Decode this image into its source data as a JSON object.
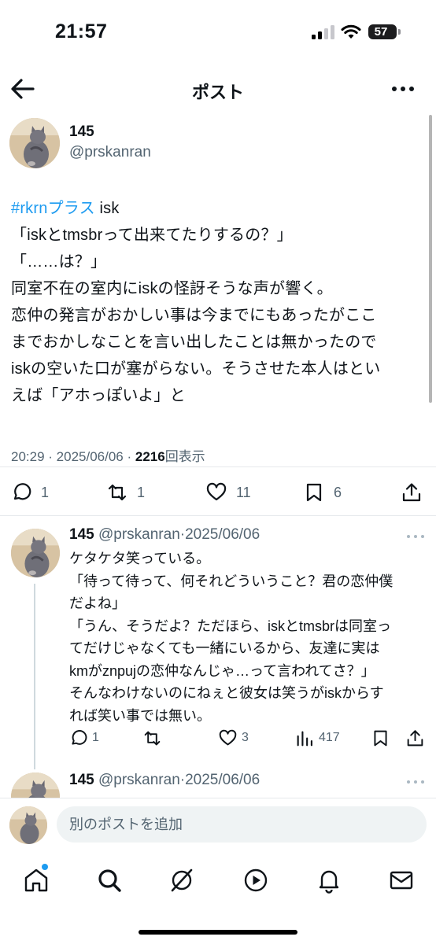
{
  "status_bar": {
    "time": "21:57",
    "battery": "57"
  },
  "header": {
    "title": "ポスト"
  },
  "post": {
    "author_name": "145",
    "author_handle": "@prskanran",
    "hashtag": "#rkrnプラス",
    "first_line_rest": " isk",
    "lines": [
      "「iskとtmsbrって出来てたりするの？」",
      "「……は？」",
      "同室不在の室内にiskの怪訝そうな声が響く。",
      "恋仲の発言がおかしい事は今までにもあったがここ",
      "までおかしなことを言い出したことは無かったので",
      "iskの空いた口が塞がらない。そうさせた本人はとい",
      "えば「アホっぽいよ」と"
    ],
    "time": "20:29",
    "date": "2025/06/06",
    "views": "2216",
    "views_label": "回表示",
    "counts": {
      "replies": "1",
      "reposts": "1",
      "likes": "11",
      "bookmarks": "6"
    }
  },
  "reply": {
    "author_name": "145",
    "author_handle": "@prskanran",
    "date": "2025/06/06",
    "lines": [
      "ケタケタ笑っている。",
      "「待って待って、何それどういうこと？君の恋仲僕",
      "だよね」",
      "「うん、そうだよ？ただほら、iskとtmsbrは同室っ",
      "てだけじゃなくても一緒にいるから、友達に実は",
      "kmがznpujの恋仲なんじゃ…って言われてさ？」",
      "そんなわけないのにねぇと彼女は笑うがiskからす",
      "れば笑い事では無い。"
    ],
    "counts": {
      "replies": "1",
      "likes": "3",
      "views": "417"
    }
  },
  "reply2": {
    "author_name": "145",
    "author_handle": "@prskanran",
    "date": "2025/06/06"
  },
  "composer": {
    "placeholder": "別のポストを追加"
  },
  "colors": {
    "accent": "#1d9bf0",
    "text": "#0f1419",
    "secondary": "#536471"
  },
  "tabs": [
    "home-icon",
    "search-icon",
    "grok-icon",
    "video-icon",
    "bell-icon",
    "mail-icon"
  ]
}
